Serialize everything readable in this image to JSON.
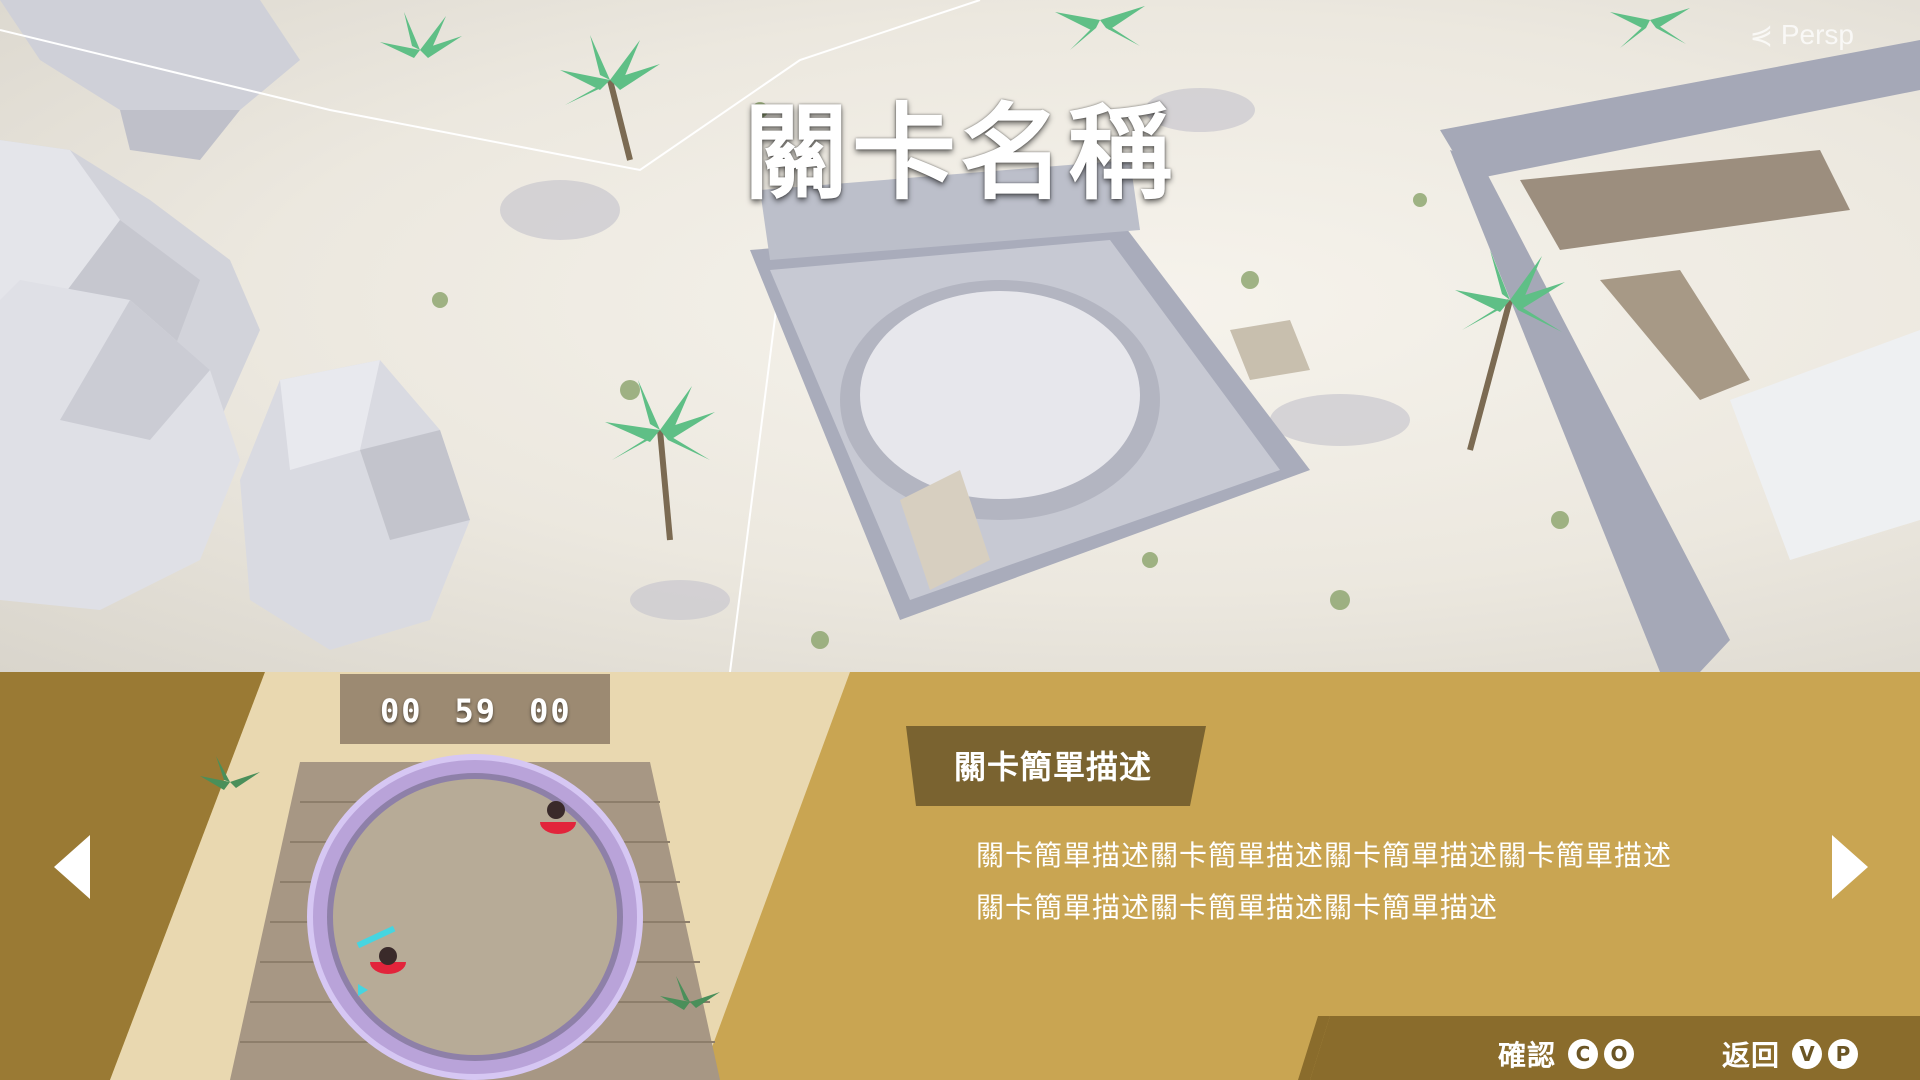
{
  "scene": {
    "view_label": "⋞ Persp",
    "level_title": "關卡名稱"
  },
  "panel": {
    "timer": [
      "00",
      "59",
      "00"
    ],
    "description_header": "關卡簡單描述",
    "description_lines": [
      "關卡簡單描述關卡簡單描述關卡簡單描述關卡簡單描述",
      "關卡簡單描述關卡簡單描述關卡簡單描述"
    ],
    "nav": {
      "prev_icon": "triangle-left-icon",
      "next_icon": "triangle-right-icon"
    },
    "hints": {
      "confirm_label": "確認",
      "confirm_buttons": [
        "C",
        "O"
      ],
      "back_label": "返回",
      "back_buttons": [
        "V",
        "P"
      ]
    }
  },
  "colors": {
    "panel_gold": "#c9a552",
    "panel_dark": "#9a7a34",
    "tag_brown": "#7a6330",
    "sand": "#ece8df",
    "palm_green": "#5fbf86"
  }
}
